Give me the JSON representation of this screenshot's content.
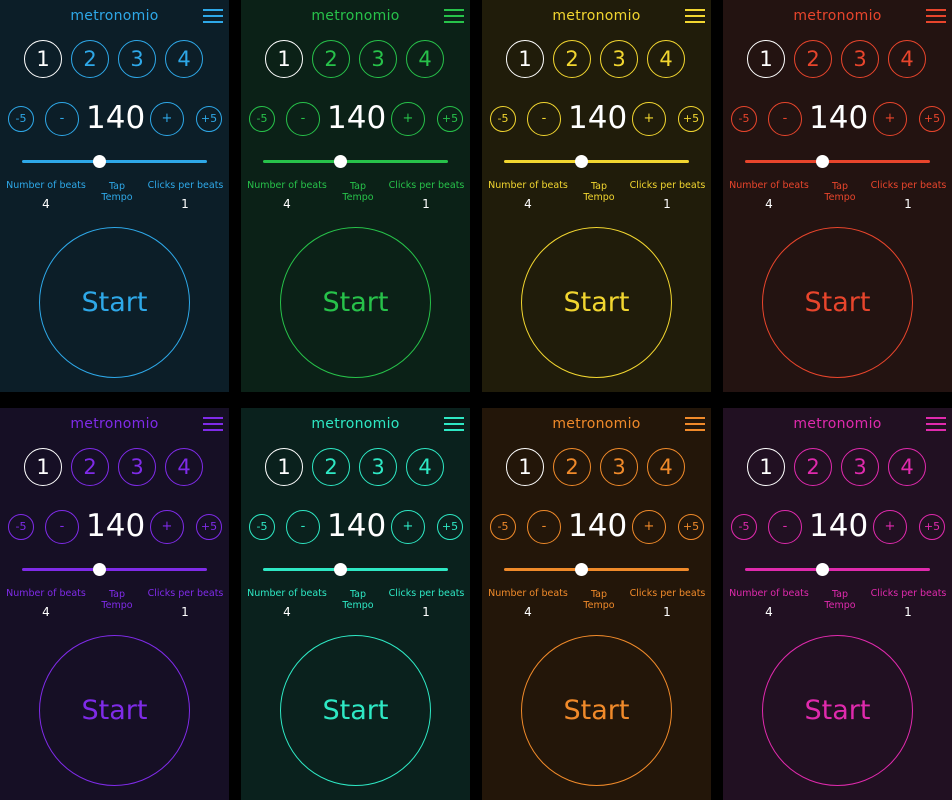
{
  "app_title": "metronomio",
  "beats": [
    "1",
    "2",
    "3",
    "4"
  ],
  "adjust": {
    "minus5": "-5",
    "minus1": "-",
    "plus1": "+",
    "plus5": "+5"
  },
  "bpm": "140",
  "labels": {
    "number_of_beats": "Number of beats",
    "tap_line1": "Tap",
    "tap_line2": "Tempo",
    "clicks_per_beats": "Clicks per beats"
  },
  "values": {
    "number_of_beats": "4",
    "clicks_per_beats": "1"
  },
  "start_label": "Start",
  "tempo_slider_fraction": 0.42,
  "themes": [
    {
      "accent": "#2ea8e8",
      "bg": "#0c1e28"
    },
    {
      "accent": "#27c24a",
      "bg": "#0b2117"
    },
    {
      "accent": "#f2d630",
      "bg": "#201c0a"
    },
    {
      "accent": "#e8452c",
      "bg": "#231311"
    },
    {
      "accent": "#7f2be8",
      "bg": "#160f25"
    },
    {
      "accent": "#2ee8c4",
      "bg": "#0a211d"
    },
    {
      "accent": "#f08a2a",
      "bg": "#231609"
    },
    {
      "accent": "#e02aad",
      "bg": "#211022"
    }
  ]
}
